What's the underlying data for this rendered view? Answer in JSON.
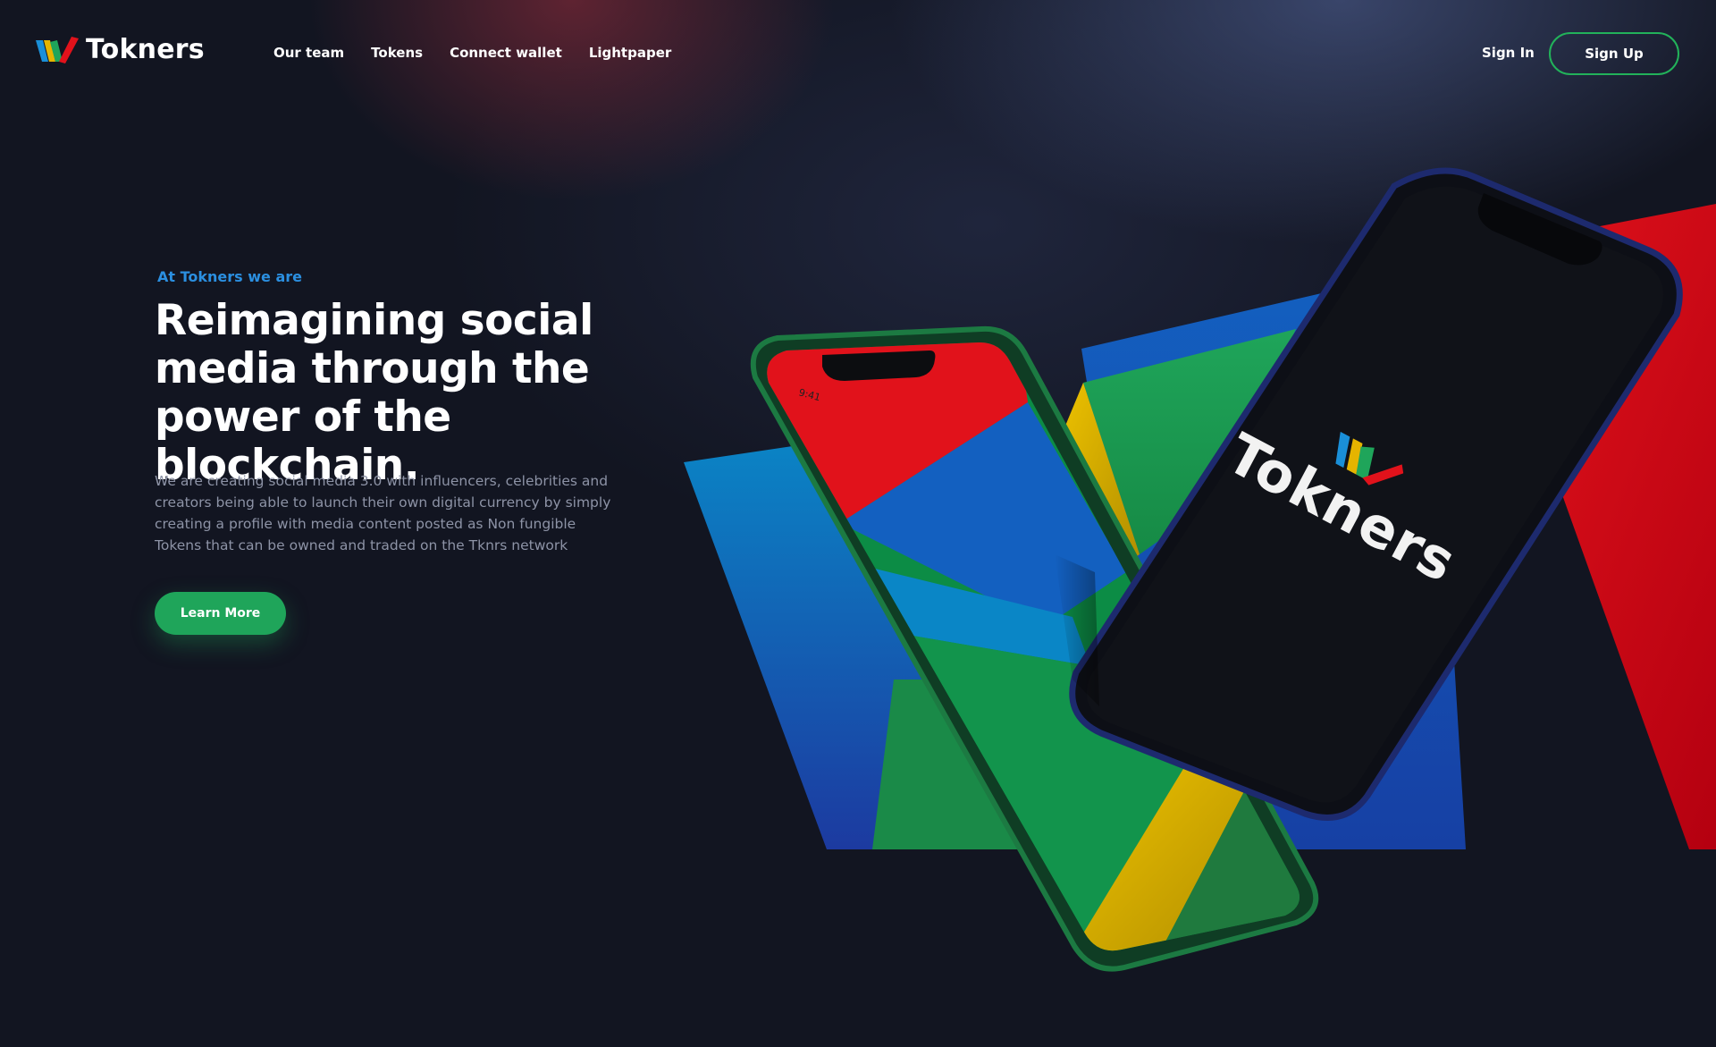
{
  "brand": {
    "name": "Tokners"
  },
  "nav": {
    "items": [
      {
        "label": "Our team"
      },
      {
        "label": "Tokens"
      },
      {
        "label": "Connect wallet"
      },
      {
        "label": "Lightpaper"
      }
    ]
  },
  "auth": {
    "sign_in": "Sign In",
    "sign_up": "Sign Up"
  },
  "hero": {
    "eyebrow": "At Tokners we are",
    "headline": [
      "Reimagining social",
      "media through the",
      "power of the blockchain."
    ],
    "description": [
      "We are creating social media 3.0 with influencers, celebrities and",
      "creators being able to launch their own digital currency by simply",
      "creating a profile with media content posted as Non fungible",
      "Tokens that can be owned and traded on the Tknrs network"
    ],
    "cta": "Learn More"
  },
  "phone_front": {
    "brand_text": "Tokners"
  },
  "phone_back": {
    "time": "9:41"
  },
  "colors": {
    "accent_green": "#1fa55a",
    "accent_blue": "#2b8fe0",
    "red": "#d7141e",
    "yellow": "#e5b400",
    "blue": "#1450b4",
    "background": "#121521"
  }
}
